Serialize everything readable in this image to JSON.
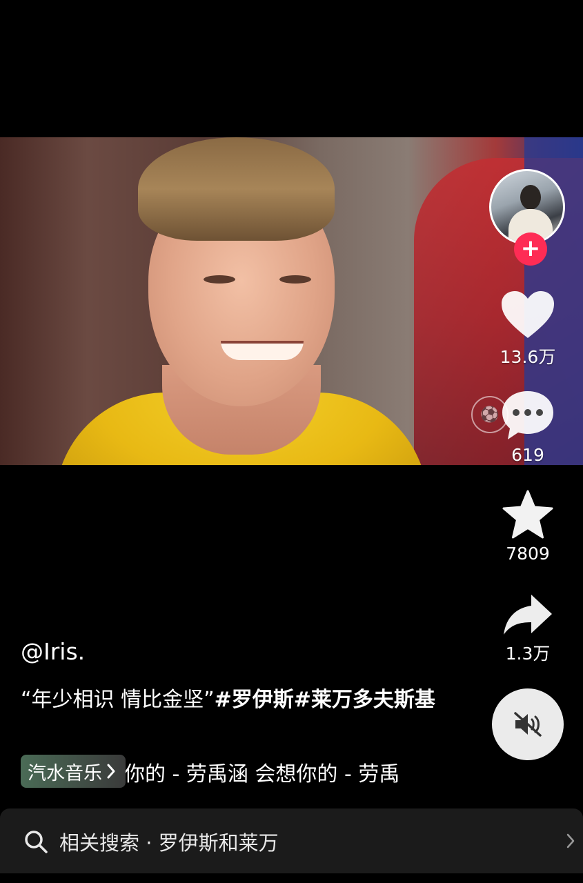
{
  "video": {
    "watermark_icon": "dfb-crest-logo"
  },
  "actions": {
    "like_count": "13.6万",
    "comment_count": "619",
    "favorite_count": "7809",
    "share_count": "1.3万"
  },
  "author": {
    "handle": "@Iris."
  },
  "description": {
    "text": "“年少相识 情比金坚”",
    "tags": [
      "#罗伊斯",
      "#莱万多夫斯基"
    ]
  },
  "music": {
    "platform_label": "汽水音乐",
    "track_scroll": "你的 - 劳禹涵  会想你的 - 劳禹"
  },
  "search": {
    "label": "相关搜索 · 罗伊斯和莱万"
  },
  "colors": {
    "accent_follow": "#fe2c55",
    "background": "#000000",
    "mute_button": "#ebebeb"
  },
  "icons": [
    "heart-icon",
    "comment-icon",
    "star-icon",
    "share-icon",
    "mute-icon",
    "search-icon",
    "chevron-right-icon",
    "plus-icon"
  ]
}
